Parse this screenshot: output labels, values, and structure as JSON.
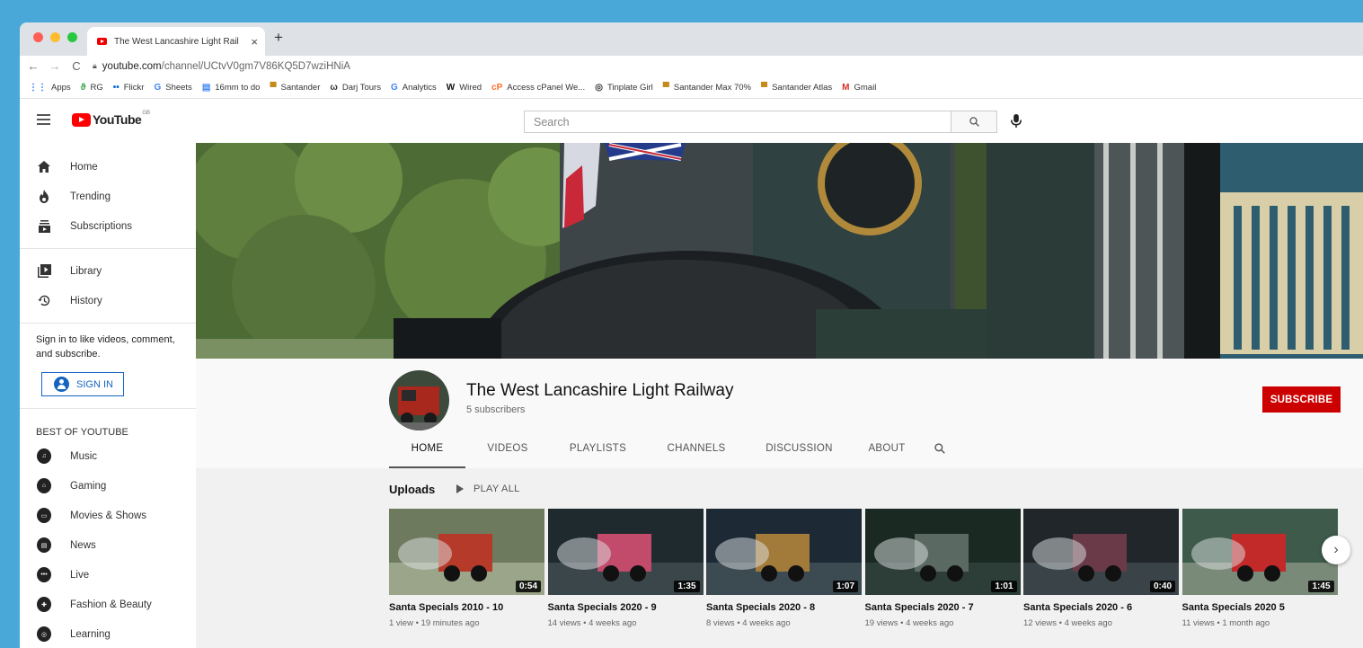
{
  "browser": {
    "tab_title": "The West Lancashire Light Rail",
    "tab_close": "×",
    "new_tab": "+",
    "back": "←",
    "forward": "→",
    "reload": "C",
    "url_host": "youtube.com",
    "url_path": "/channel/UCtvV0gm7V86KQ5D7wziHNiA",
    "bookmarks": [
      {
        "icon": "⋮⋮",
        "label": "Apps",
        "color": "#1a73e8"
      },
      {
        "icon": "ϑ",
        "label": "RG",
        "color": "#2e9d3e"
      },
      {
        "icon": "••",
        "label": "Flickr",
        "color": "#0063dc"
      },
      {
        "icon": "G",
        "label": "Sheets",
        "color": "#4285f4"
      },
      {
        "icon": "▤",
        "label": "16mm to do",
        "color": "#4285f4"
      },
      {
        "icon": "▀",
        "label": "Santander",
        "color": "#c48a1a"
      },
      {
        "icon": "ω",
        "label": "Darj Tours",
        "color": "#333333"
      },
      {
        "icon": "G",
        "label": "Analytics",
        "color": "#4285f4"
      },
      {
        "icon": "W",
        "label": "Wired",
        "color": "#111111"
      },
      {
        "icon": "cP",
        "label": "Access cPanel We...",
        "color": "#ff6c2c"
      },
      {
        "icon": "◎",
        "label": "Tinplate Girl",
        "color": "#333333"
      },
      {
        "icon": "▀",
        "label": "Santander Max 70%",
        "color": "#c48a1a"
      },
      {
        "icon": "▀",
        "label": "Santander Atlas",
        "color": "#c48a1a"
      },
      {
        "icon": "M",
        "label": "Gmail",
        "color": "#d93025"
      }
    ]
  },
  "yt": {
    "logo_word": "YouTube",
    "logo_country": "GB",
    "search_placeholder": "Search"
  },
  "sidebar": {
    "main": [
      {
        "label": "Home",
        "icon": "home-icon"
      },
      {
        "label": "Trending",
        "icon": "fire-icon"
      },
      {
        "label": "Subscriptions",
        "icon": "subscriptions-icon"
      }
    ],
    "lib": [
      {
        "label": "Library",
        "icon": "library-icon"
      },
      {
        "label": "History",
        "icon": "history-icon"
      }
    ],
    "signin_text": "Sign in to like videos, comment, and subscribe.",
    "signin_button": "SIGN IN",
    "best_heading": "BEST OF YOUTUBE",
    "best": [
      {
        "label": "Music",
        "icon": "music-icon"
      },
      {
        "label": "Gaming",
        "icon": "gaming-icon"
      },
      {
        "label": "Movies & Shows",
        "icon": "movies-icon"
      },
      {
        "label": "News",
        "icon": "news-icon"
      },
      {
        "label": "Live",
        "icon": "live-icon"
      },
      {
        "label": "Fashion & Beauty",
        "icon": "fashion-icon"
      },
      {
        "label": "Learning",
        "icon": "learning-icon"
      }
    ]
  },
  "channel": {
    "name": "The West Lancashire Light Railway",
    "subscribers": "5 subscribers",
    "subscribe_button": "SUBSCRIBE",
    "tabs": [
      "HOME",
      "VIDEOS",
      "PLAYLISTS",
      "CHANNELS",
      "DISCUSSION",
      "ABOUT"
    ],
    "active_tab": "HOME"
  },
  "uploads": {
    "heading": "Uploads",
    "play_all": "PLAY ALL",
    "next": "›",
    "videos": [
      {
        "title": "Santa Specials 2010 - 10",
        "meta": "1 view • 19 minutes ago",
        "duration": "0:54"
      },
      {
        "title": "Santa Specials 2020 - 9",
        "meta": "14 views • 4 weeks ago",
        "duration": "1:35"
      },
      {
        "title": "Santa Specials 2020 - 8",
        "meta": "8 views • 4 weeks ago",
        "duration": "1:07"
      },
      {
        "title": "Santa Specials 2020 - 7",
        "meta": "19 views • 4 weeks ago",
        "duration": "1:01"
      },
      {
        "title": "Santa Specials 2020 - 6",
        "meta": "12 views • 4 weeks ago",
        "duration": "0:40"
      },
      {
        "title": "Santa Specials 2020 5",
        "meta": "11 views • 1 month ago",
        "duration": "1:45"
      }
    ]
  },
  "colors": {
    "desktop": "#4aa8d8",
    "brand_red": "#ff0000",
    "subscribe_red": "#cc0000",
    "signin_blue": "#1565c0"
  }
}
